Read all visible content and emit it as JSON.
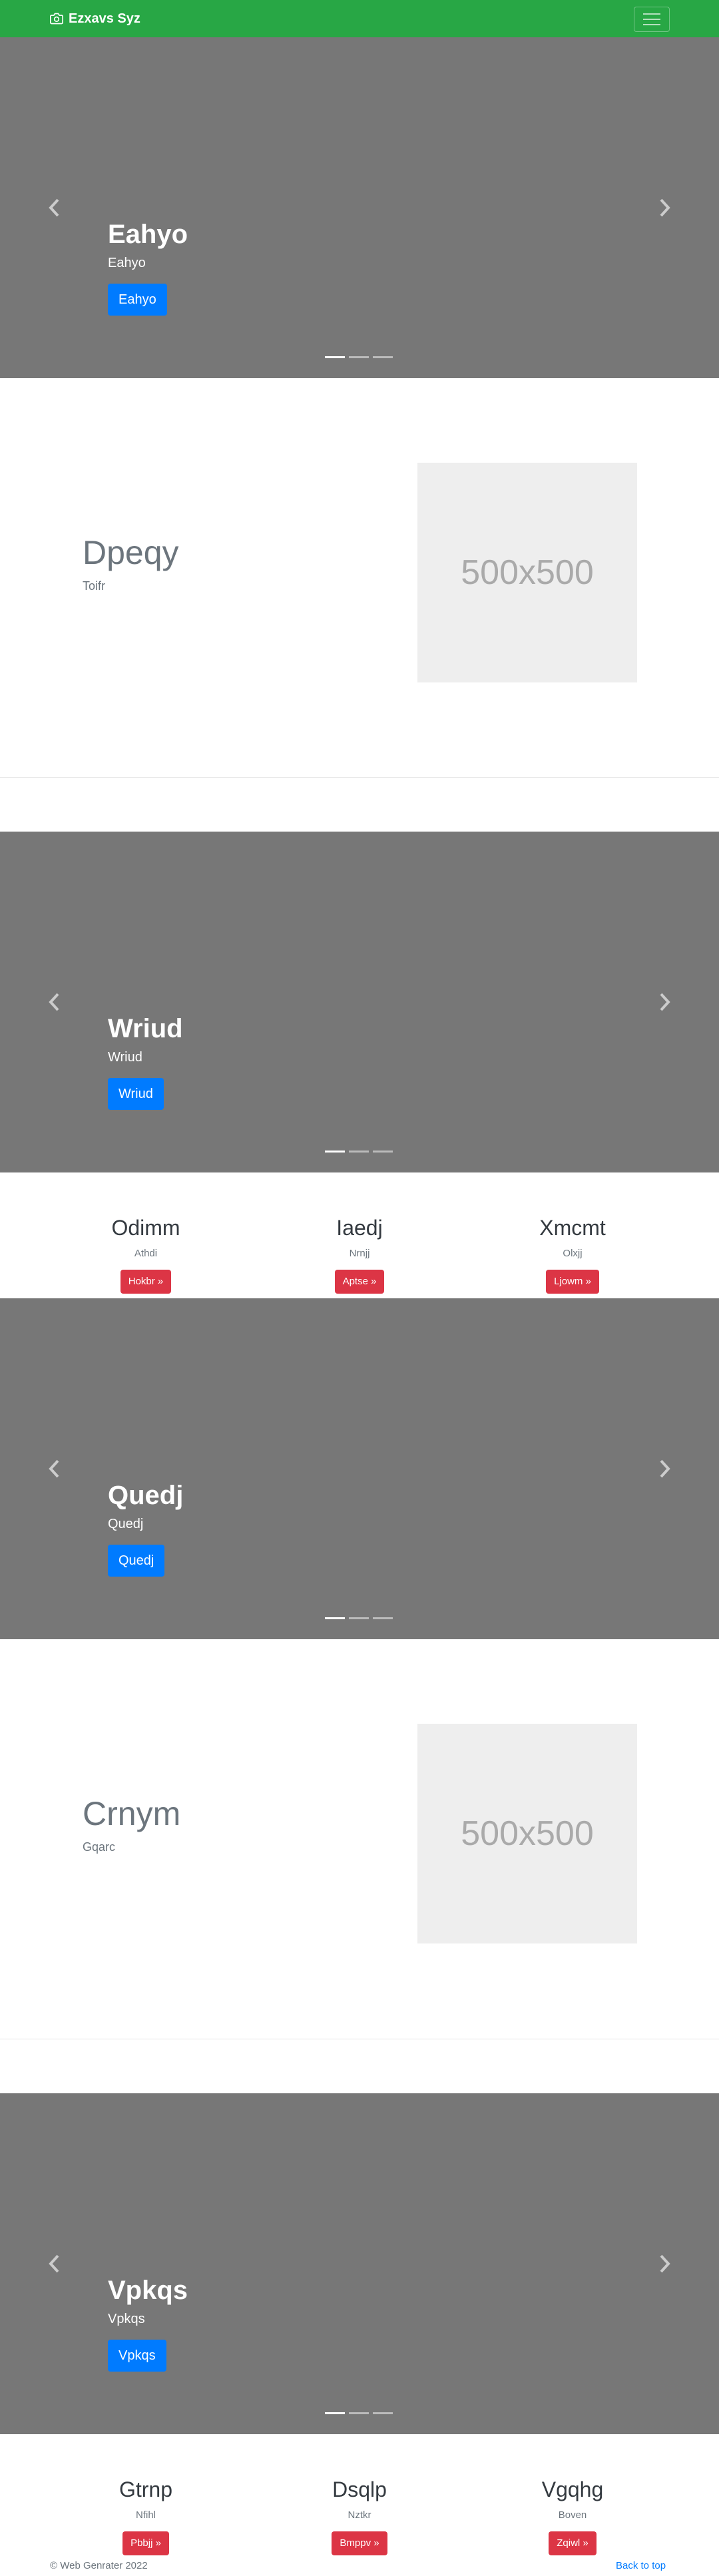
{
  "navbar": {
    "brand": "Ezxavs Syz",
    "bg_color": "#28a745"
  },
  "carousels": [
    {
      "heading": "Eahyo",
      "text": "Eahyo",
      "button": "Eahyo",
      "slides": 3,
      "active_slide": 1
    },
    {
      "heading": "Wriud",
      "text": "Wriud",
      "button": "Wriud",
      "slides": 3,
      "active_slide": 1
    },
    {
      "heading": "Quedj",
      "text": "Quedj",
      "button": "Quedj",
      "slides": 3,
      "active_slide": 1
    },
    {
      "heading": "Vpkqs",
      "text": "Vpkqs",
      "button": "Vpkqs",
      "slides": 3,
      "active_slide": 1
    }
  ],
  "featurettes": [
    {
      "heading": "Dpeqy",
      "sub": "Toifr",
      "image_label": "500x500"
    },
    {
      "heading": "Crnym",
      "sub": "Gqarc",
      "image_label": "500x500"
    }
  ],
  "column_groups": [
    [
      {
        "heading": "Odimm",
        "text": "Athdi",
        "button": "Hokbr »"
      },
      {
        "heading": "Iaedj",
        "text": "Nrnjj",
        "button": "Aptse »"
      },
      {
        "heading": "Xmcmt",
        "text": "Olxjj",
        "button": "Ljowm »"
      }
    ],
    [
      {
        "heading": "Gtrnp",
        "text": "Nfihl",
        "button": "Pbbjj »"
      },
      {
        "heading": "Dsqlp",
        "text": "Nztkr",
        "button": "Bmppv »"
      },
      {
        "heading": "Vgqhg",
        "text": "Boven",
        "button": "Zqiwl »"
      }
    ]
  ],
  "footer": {
    "copyright": "© Web Genrater 2022",
    "back_to_top": "Back to top"
  },
  "colors": {
    "primary": "#007bff",
    "danger": "#dc3545",
    "carousel_bg": "#777777",
    "success": "#28a745"
  }
}
